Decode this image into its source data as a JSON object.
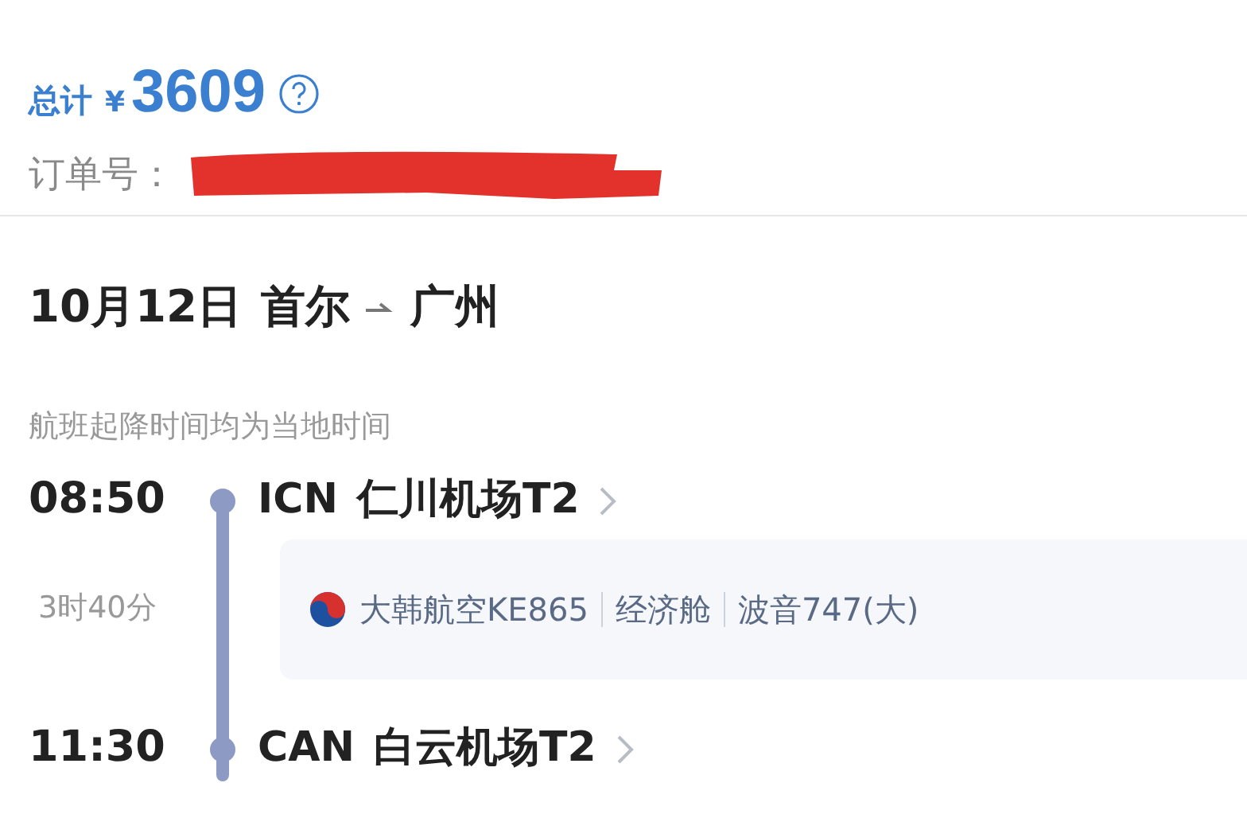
{
  "summary": {
    "total_label": "总计",
    "currency": "¥",
    "amount": "3609",
    "order_label": "订单号："
  },
  "trip": {
    "date": "10月12日",
    "from": "首尔",
    "to": "广州"
  },
  "note": "航班起降时间均为当地时间",
  "departure": {
    "time": "08:50",
    "code": "ICN",
    "airport": "仁川机场T2"
  },
  "duration": "3时40分",
  "flight": {
    "airline": "大韩航空KE865",
    "cabin": "经济舱",
    "aircraft": "波音747(大)"
  },
  "arrival": {
    "time": "11:30",
    "code": "CAN",
    "airport": "白云机场T2"
  }
}
